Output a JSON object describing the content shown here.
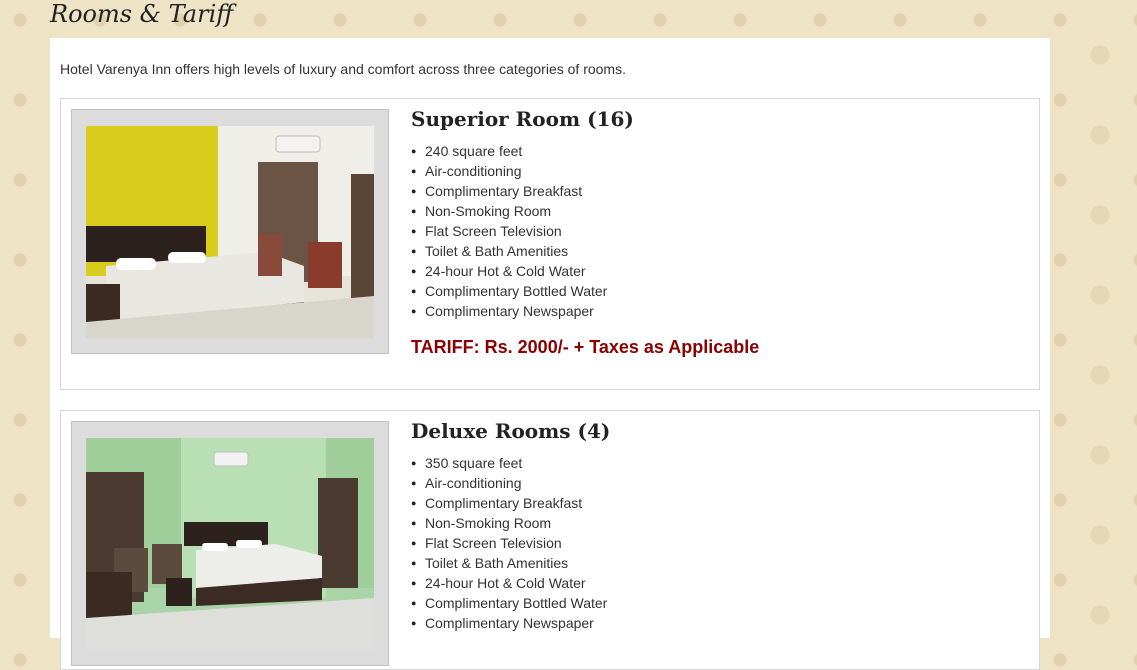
{
  "page": {
    "title": "Rooms & Tariff"
  },
  "intro": "Hotel Varenya Inn offers high levels of luxury and comfort across three categories of rooms.",
  "rooms": [
    {
      "title": "Superior Room (16)",
      "amenities": [
        "240 square feet",
        "Air-conditioning",
        "Complimentary Breakfast",
        "Non-Smoking Room",
        "Flat Screen Television",
        "Toilet & Bath Amenities",
        "24-hour Hot & Cold Water",
        "Complimentary Bottled Water",
        "Complimentary Newspaper"
      ],
      "tariff": "TARIFF: Rs. 2000/- + Taxes as Applicable"
    },
    {
      "title": "Deluxe Rooms (4)",
      "amenities": [
        "350 square feet",
        "Air-conditioning",
        "Complimentary Breakfast",
        "Non-Smoking Room",
        "Flat Screen Television",
        "Toilet & Bath Amenities",
        "24-hour Hot & Cold Water",
        "Complimentary Bottled Water",
        "Complimentary Newspaper"
      ]
    }
  ],
  "colors": {
    "tariff": "#8b0000",
    "background": "#efe3c6"
  }
}
